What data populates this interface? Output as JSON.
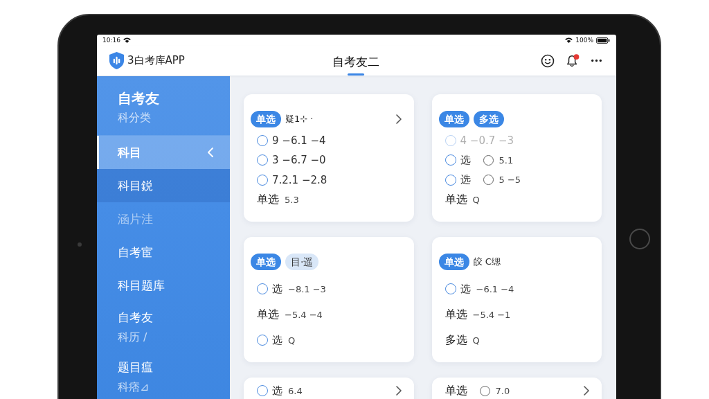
{
  "status_bar": {
    "time": "10:16",
    "battery": "100%"
  },
  "header": {
    "app_name": "3白考库APP",
    "tabs": [
      {
        "label": "自考友二",
        "selected": true
      }
    ],
    "notification": true
  },
  "sidebar": {
    "title": "自考友",
    "subtitle": "科分类",
    "items": [
      {
        "label": "科目",
        "selected": true,
        "expanded": true,
        "disabled": false,
        "children": [
          {
            "label": "科目鋭",
            "selected": false,
            "disabled": false
          }
        ]
      },
      {
        "label": "涵片洼",
        "selected": false,
        "expanded": false,
        "disabled": true
      },
      {
        "label": "自考宦",
        "selected": false,
        "expanded": false,
        "disabled": false
      },
      {
        "label": "科目题库",
        "selected": false,
        "expanded": false,
        "disabled": false
      },
      {
        "label": "自考友",
        "sub": "科历 /",
        "selected": false,
        "expanded": false,
        "disabled": false
      },
      {
        "label": "题目瘟",
        "sub": "科痞⊿",
        "selected": false,
        "expanded": false,
        "disabled": false
      }
    ]
  },
  "cards": [
    {
      "arrow": true,
      "tags": [
        {
          "kind": "solid",
          "text": "单选"
        },
        {
          "kind": "plain",
          "text": "疑1⊹ ·"
        }
      ],
      "options": [
        {
          "kind": "radio",
          "text": "9 −6.1 −4",
          "selected": false,
          "disabled": false
        },
        {
          "kind": "radio",
          "text": "3 −6.7 −0",
          "selected": false,
          "disabled": false
        },
        {
          "kind": "radio",
          "text": "7.2.1 −2.8",
          "selected": false,
          "disabled": false
        },
        {
          "kind": "plain",
          "text": "单选",
          "detail": "5.3",
          "disabled": false
        }
      ]
    },
    {
      "arrow": false,
      "tags": [
        {
          "kind": "solid",
          "text": "单选"
        },
        {
          "kind": "solid",
          "text": "多选"
        }
      ],
      "options": [
        {
          "kind": "radio",
          "text": "4 −0.7 −3",
          "selected": false,
          "disabled": true
        },
        {
          "kind": "radio",
          "text": "选",
          "sub": {
            "text": "5.1",
            "selected": false
          },
          "selected": false,
          "disabled": false
        },
        {
          "kind": "radio",
          "text": "选",
          "sub": {
            "text": "5 −5",
            "selected": false
          },
          "selected": false,
          "disabled": false
        },
        {
          "kind": "plain",
          "text": "单选",
          "detail": "Q",
          "disabled": false
        }
      ]
    },
    {
      "arrow": false,
      "tags": [
        {
          "kind": "solid",
          "text": "单选"
        },
        {
          "kind": "soft",
          "text": "目·遥"
        }
      ],
      "options": [
        {
          "kind": "radio",
          "text": "选",
          "detail": "−8.1 −3",
          "selected": false,
          "disabled": false
        },
        {
          "kind": "plain",
          "text": "单选",
          "detail": "−5.4 −4",
          "disabled": false
        },
        {
          "kind": "radio",
          "text": "选",
          "detail": "Q",
          "selected": false,
          "disabled": false
        }
      ]
    },
    {
      "arrow": false,
      "tags": [
        {
          "kind": "solid",
          "text": "单选"
        },
        {
          "kind": "plain",
          "text": "皎 C缌"
        }
      ],
      "options": [
        {
          "kind": "radio",
          "text": "选",
          "detail": "−6.1 −4",
          "selected": false,
          "disabled": false
        },
        {
          "kind": "plain",
          "text": "单选",
          "detail": "−5.4 −1",
          "disabled": false
        },
        {
          "kind": "plain",
          "text": "多选",
          "detail": "Q",
          "disabled": false
        }
      ]
    },
    {
      "arrow": true,
      "options": [
        {
          "kind": "radio",
          "text": "选",
          "detail": "6.4",
          "selected": false,
          "disabled": false
        }
      ]
    },
    {
      "arrow": true,
      "options": [
        {
          "kind": "plain",
          "text": "单选",
          "sub": {
            "text": "7.0",
            "selected": false
          },
          "disabled": false
        }
      ]
    }
  ]
}
